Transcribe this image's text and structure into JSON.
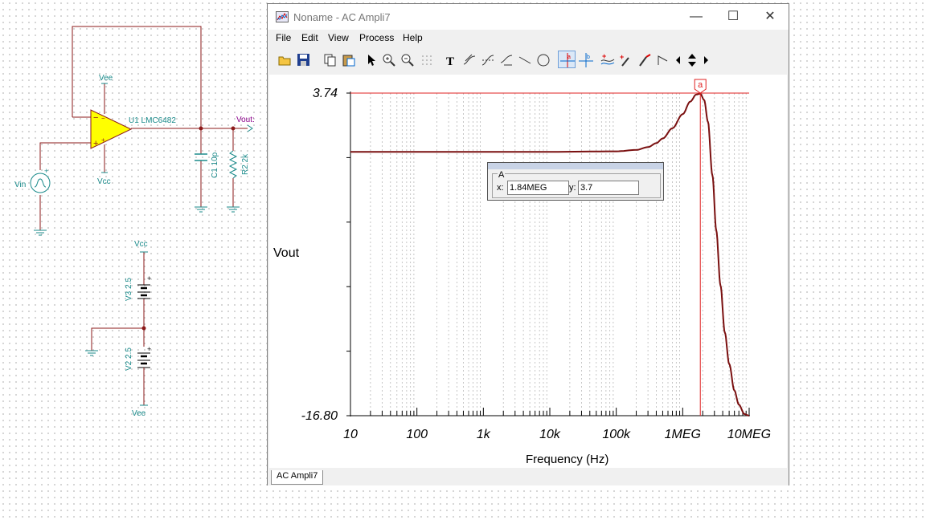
{
  "schematic": {
    "opamp_label": "U1 LMC6482",
    "vee_top": "Vee",
    "vcc_bottom": "Vcc",
    "vout_label": "Vout:",
    "vin_label": "Vin",
    "c1_label": "C1 10p",
    "r2_label": "R2 2k",
    "vcc_supply": "Vcc",
    "v3_label": "V3 2.5",
    "v2_label": "V2 2.5",
    "vee_supply": "Vee",
    "plus": "+"
  },
  "window": {
    "title": "Noname - AC Ampli7",
    "menu": [
      "File",
      "Edit",
      "View",
      "Process",
      "Help"
    ],
    "tab": "AC Ampli7"
  },
  "toolbar": {
    "icons": [
      "open-icon",
      "save-icon",
      "copy-icon",
      "paste-icon",
      "pointer-icon",
      "zoom-in-icon",
      "zoom-out-icon",
      "grid-icon",
      "text-icon",
      "curve-edit-icon",
      "curve-icon",
      "curve-label-icon",
      "line-icon",
      "circle-icon",
      "cursor-a-icon",
      "cursor-b-icon",
      "add-curve-icon",
      "probe-icon",
      "marker-icon",
      "nav-left-icon",
      "nav-updown-icon",
      "nav-right-icon"
    ],
    "active": "cursor-a-icon"
  },
  "chart_data": {
    "type": "line",
    "xlabel": "Frequency (Hz)",
    "ylabel": "Vout",
    "xscale": "log",
    "xlim": [
      10,
      10000000
    ],
    "ylim": [
      -16.8,
      3.74
    ],
    "ytick_labels": [
      "3.74",
      "-16.80"
    ],
    "xtick_labels": [
      "10",
      "100",
      "1k",
      "10k",
      "100k",
      "1MEG",
      "10MEG"
    ],
    "grid": true,
    "series": [
      {
        "color": "#7a1010",
        "x": [
          10,
          100,
          1000,
          10000,
          100000,
          200000,
          300000,
          400000,
          500000,
          700000,
          1000000,
          1300000,
          1600000,
          1840000,
          2100000,
          2400000,
          2800000,
          3200000,
          3700000,
          4300000,
          5000000,
          6000000,
          7000000,
          8500000,
          10000000
        ],
        "y": [
          0.0,
          0.0,
          0.0,
          0.0,
          0.03,
          0.12,
          0.3,
          0.55,
          0.85,
          1.5,
          2.4,
          3.2,
          3.65,
          3.7,
          3.3,
          1.9,
          -1.5,
          -5.0,
          -8.5,
          -11.5,
          -13.5,
          -15.2,
          -16.1,
          -16.7,
          -16.8
        ]
      }
    ],
    "cursor": {
      "name": "a",
      "x": 1840000,
      "x_label": "1.84MEG",
      "y_label": "3.7",
      "level": 3.74
    }
  },
  "cursor_box": {
    "title": "A",
    "x_label": "x:",
    "x_value": "1.84MEG",
    "y_label": "y:",
    "y_value": "3.7"
  }
}
